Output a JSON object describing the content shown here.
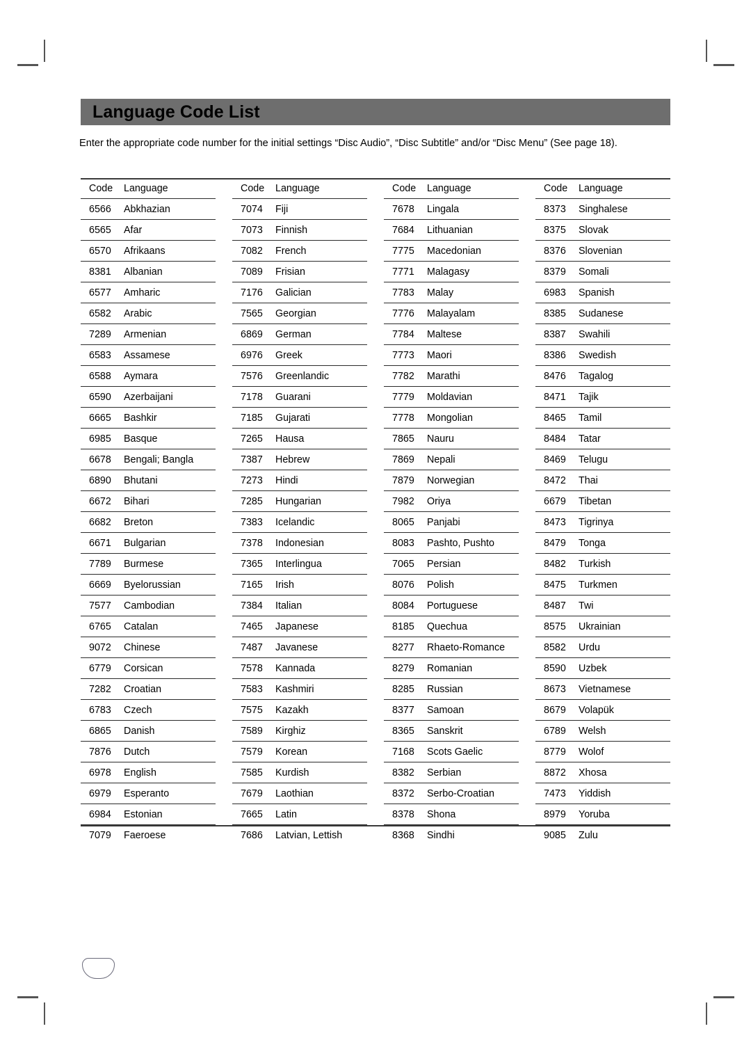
{
  "page": {
    "title": "Language Code List",
    "intro": "Enter the appropriate code number for the initial settings “Disc Audio”, “Disc Subtitle” and/or “Disc Menu” (See page 18).",
    "page_badge_label": "",
    "header_bar_color": "#6e6e6e",
    "text_color": "#000000",
    "rule_color": "#2a2a2a",
    "crop_mark_color": "#555555"
  },
  "table": {
    "headers": {
      "code": "Code",
      "language": "Language"
    },
    "columns": [
      {
        "id": "column-1",
        "rows": [
          {
            "code": "6566",
            "language": "Abkhazian"
          },
          {
            "code": "6565",
            "language": "Afar"
          },
          {
            "code": "6570",
            "language": "Afrikaans"
          },
          {
            "code": "8381",
            "language": "Albanian"
          },
          {
            "code": "6577",
            "language": "Amharic"
          },
          {
            "code": "6582",
            "language": "Arabic"
          },
          {
            "code": "7289",
            "language": "Armenian"
          },
          {
            "code": "6583",
            "language": "Assamese"
          },
          {
            "code": "6588",
            "language": "Aymara"
          },
          {
            "code": "6590",
            "language": "Azerbaijani"
          },
          {
            "code": "6665",
            "language": "Bashkir"
          },
          {
            "code": "6985",
            "language": "Basque"
          },
          {
            "code": "6678",
            "language": "Bengali; Bangla"
          },
          {
            "code": "6890",
            "language": "Bhutani"
          },
          {
            "code": "6672",
            "language": "Bihari"
          },
          {
            "code": "6682",
            "language": "Breton"
          },
          {
            "code": "6671",
            "language": "Bulgarian"
          },
          {
            "code": "7789",
            "language": "Burmese"
          },
          {
            "code": "6669",
            "language": "Byelorussian"
          },
          {
            "code": "7577",
            "language": "Cambodian"
          },
          {
            "code": "6765",
            "language": "Catalan"
          },
          {
            "code": "9072",
            "language": "Chinese"
          },
          {
            "code": "6779",
            "language": "Corsican"
          },
          {
            "code": "7282",
            "language": "Croatian"
          },
          {
            "code": "6783",
            "language": "Czech"
          },
          {
            "code": "6865",
            "language": "Danish"
          },
          {
            "code": "7876",
            "language": "Dutch"
          },
          {
            "code": "6978",
            "language": "English"
          },
          {
            "code": "6979",
            "language": "Esperanto"
          },
          {
            "code": "6984",
            "language": "Estonian"
          },
          {
            "code": "7079",
            "language": "Faeroese"
          }
        ]
      },
      {
        "id": "column-2",
        "rows": [
          {
            "code": "7074",
            "language": "Fiji"
          },
          {
            "code": "7073",
            "language": "Finnish"
          },
          {
            "code": "7082",
            "language": "French"
          },
          {
            "code": "7089",
            "language": "Frisian"
          },
          {
            "code": "7176",
            "language": "Galician"
          },
          {
            "code": "7565",
            "language": "Georgian"
          },
          {
            "code": "6869",
            "language": "German"
          },
          {
            "code": "6976",
            "language": "Greek"
          },
          {
            "code": "7576",
            "language": "Greenlandic"
          },
          {
            "code": "7178",
            "language": "Guarani"
          },
          {
            "code": "7185",
            "language": "Gujarati"
          },
          {
            "code": "7265",
            "language": "Hausa"
          },
          {
            "code": "7387",
            "language": "Hebrew"
          },
          {
            "code": "7273",
            "language": "Hindi"
          },
          {
            "code": "7285",
            "language": "Hungarian"
          },
          {
            "code": "7383",
            "language": "Icelandic"
          },
          {
            "code": "7378",
            "language": "Indonesian"
          },
          {
            "code": "7365",
            "language": "Interlingua"
          },
          {
            "code": "7165",
            "language": "Irish"
          },
          {
            "code": "7384",
            "language": "Italian"
          },
          {
            "code": "7465",
            "language": "Japanese"
          },
          {
            "code": "7487",
            "language": "Javanese"
          },
          {
            "code": "7578",
            "language": "Kannada"
          },
          {
            "code": "7583",
            "language": "Kashmiri"
          },
          {
            "code": "7575",
            "language": "Kazakh"
          },
          {
            "code": "7589",
            "language": "Kirghiz"
          },
          {
            "code": "7579",
            "language": "Korean"
          },
          {
            "code": "7585",
            "language": "Kurdish"
          },
          {
            "code": "7679",
            "language": "Laothian"
          },
          {
            "code": "7665",
            "language": "Latin"
          },
          {
            "code": "7686",
            "language": "Latvian, Lettish"
          }
        ]
      },
      {
        "id": "column-3",
        "rows": [
          {
            "code": "7678",
            "language": "Lingala"
          },
          {
            "code": "7684",
            "language": "Lithuanian"
          },
          {
            "code": "7775",
            "language": "Macedonian"
          },
          {
            "code": "7771",
            "language": "Malagasy"
          },
          {
            "code": "7783",
            "language": "Malay"
          },
          {
            "code": "7776",
            "language": "Malayalam"
          },
          {
            "code": "7784",
            "language": "Maltese"
          },
          {
            "code": "7773",
            "language": "Maori"
          },
          {
            "code": "7782",
            "language": "Marathi"
          },
          {
            "code": "7779",
            "language": "Moldavian"
          },
          {
            "code": "7778",
            "language": "Mongolian"
          },
          {
            "code": "7865",
            "language": "Nauru"
          },
          {
            "code": "7869",
            "language": "Nepali"
          },
          {
            "code": "7879",
            "language": "Norwegian"
          },
          {
            "code": "7982",
            "language": "Oriya"
          },
          {
            "code": "8065",
            "language": "Panjabi"
          },
          {
            "code": "8083",
            "language": "Pashto, Pushto"
          },
          {
            "code": "7065",
            "language": "Persian"
          },
          {
            "code": "8076",
            "language": "Polish"
          },
          {
            "code": "8084",
            "language": "Portuguese"
          },
          {
            "code": "8185",
            "language": "Quechua"
          },
          {
            "code": "8277",
            "language": "Rhaeto-Romance"
          },
          {
            "code": "8279",
            "language": "Romanian"
          },
          {
            "code": "8285",
            "language": "Russian"
          },
          {
            "code": "8377",
            "language": "Samoan"
          },
          {
            "code": "8365",
            "language": "Sanskrit"
          },
          {
            "code": "7168",
            "language": "Scots Gaelic"
          },
          {
            "code": "8382",
            "language": "Serbian"
          },
          {
            "code": "8372",
            "language": "Serbo-Croatian"
          },
          {
            "code": "8378",
            "language": "Shona"
          },
          {
            "code": "8368",
            "language": "Sindhi"
          }
        ]
      },
      {
        "id": "column-4",
        "rows": [
          {
            "code": "8373",
            "language": "Singhalese"
          },
          {
            "code": "8375",
            "language": "Slovak"
          },
          {
            "code": "8376",
            "language": "Slovenian"
          },
          {
            "code": "8379",
            "language": "Somali"
          },
          {
            "code": "6983",
            "language": "Spanish"
          },
          {
            "code": "8385",
            "language": "Sudanese"
          },
          {
            "code": "8387",
            "language": "Swahili"
          },
          {
            "code": "8386",
            "language": "Swedish"
          },
          {
            "code": "8476",
            "language": "Tagalog"
          },
          {
            "code": "8471",
            "language": "Tajik"
          },
          {
            "code": "8465",
            "language": "Tamil"
          },
          {
            "code": "8484",
            "language": "Tatar"
          },
          {
            "code": "8469",
            "language": "Telugu"
          },
          {
            "code": "8472",
            "language": "Thai"
          },
          {
            "code": "6679",
            "language": "Tibetan"
          },
          {
            "code": "8473",
            "language": "Tigrinya"
          },
          {
            "code": "8479",
            "language": "Tonga"
          },
          {
            "code": "8482",
            "language": "Turkish"
          },
          {
            "code": "8475",
            "language": "Turkmen"
          },
          {
            "code": "8487",
            "language": "Twi"
          },
          {
            "code": "8575",
            "language": "Ukrainian"
          },
          {
            "code": "8582",
            "language": "Urdu"
          },
          {
            "code": "8590",
            "language": "Uzbek"
          },
          {
            "code": "8673",
            "language": "Vietnamese"
          },
          {
            "code": "8679",
            "language": "Volapük"
          },
          {
            "code": "6789",
            "language": "Welsh"
          },
          {
            "code": "8779",
            "language": "Wolof"
          },
          {
            "code": "8872",
            "language": "Xhosa"
          },
          {
            "code": "7473",
            "language": "Yiddish"
          },
          {
            "code": "8979",
            "language": "Yoruba"
          },
          {
            "code": "9085",
            "language": "Zulu"
          }
        ]
      }
    ]
  }
}
